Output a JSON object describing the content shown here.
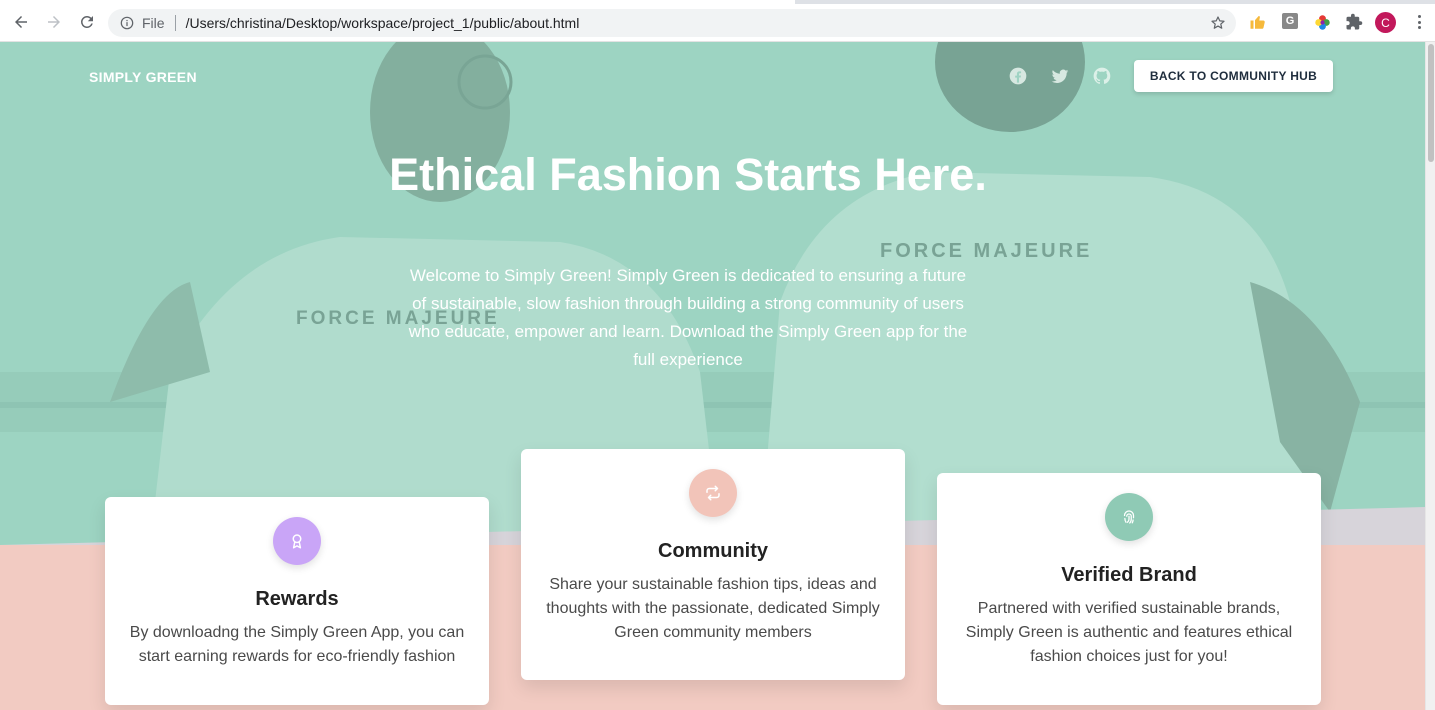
{
  "browser": {
    "scheme_label": "File",
    "url": "/Users/christina/Desktop/workspace/project_1/public/about.html",
    "profile_initial": "C",
    "extension_g_label": "G"
  },
  "nav": {
    "brand": "SIMPLY GREEN",
    "social": [
      "facebook-icon",
      "twitter-icon",
      "github-icon"
    ],
    "cta": "BACK TO COMMUNITY HUB"
  },
  "hero": {
    "title": "Ethical Fashion Starts Here.",
    "text": "Welcome to Simply Green! Simply Green is dedicated to ensuring a future of sustainable, slow fashion through building a strong community of users who educate, empower and learn. Download the Simply Green app for the full experience"
  },
  "features": [
    {
      "icon": "award-ribbon-icon",
      "color": "#c9a5f7",
      "title": "Rewards",
      "text": "By downloadng the Simply Green App, you can start earning rewards for eco-friendly fashion"
    },
    {
      "icon": "repeat-arrows-icon",
      "color": "#f2c4b9",
      "title": "Community",
      "text": "Share your sustainable fashion tips, ideas and thoughts with the passionate, dedicated Simply Green community members"
    },
    {
      "icon": "fingerprint-icon",
      "color": "#8fcab5",
      "title": "Verified Brand",
      "text": "Partnered with verified sustainable brands, Simply Green is authentic and features ethical fashion choices just for you!"
    }
  ],
  "colors": {
    "hero_tint": "#9fd3c3",
    "lower_band": "#f2cbc2",
    "wedge": "#d7d4da"
  }
}
